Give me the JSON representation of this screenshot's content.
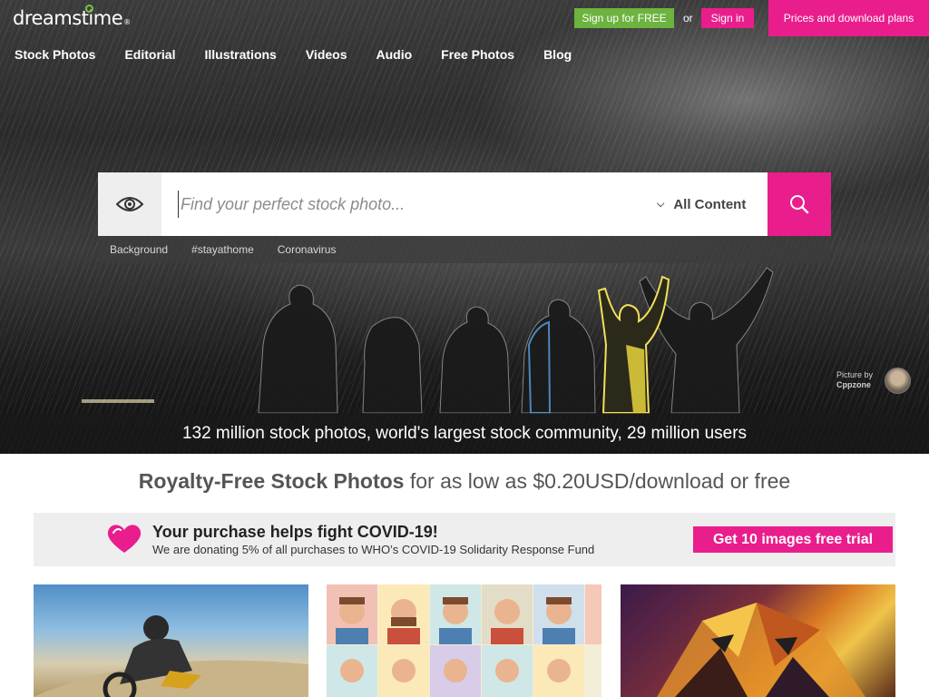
{
  "header": {
    "logo_text": "dreamstime",
    "logo_mark": "®",
    "signup_label": "Sign up for FREE",
    "or_text": "or",
    "signin_label": "Sign in",
    "prices_label": "Prices and download plans"
  },
  "nav": {
    "items": [
      "Stock Photos",
      "Editorial",
      "Illustrations",
      "Videos",
      "Audio",
      "Free Photos",
      "Blog"
    ]
  },
  "search": {
    "placeholder": "Find your perfect stock photo...",
    "value": "",
    "content_filter": "All Content",
    "tags": [
      "Background",
      "#stayathome",
      "Coronavirus"
    ]
  },
  "hero": {
    "credit_label": "Picture by",
    "credit_author": "Cppzone",
    "stats": "132 million stock photos, world's largest stock community, 29 million users"
  },
  "tagline": {
    "strong": "Royalty-Free Stock Photos",
    "rest": " for as low as $0.20USD/download or free"
  },
  "covid": {
    "title": "Your purchase helps fight COVID-19!",
    "subtitle": "We are donating 5% of all purchases to WHO’s COVID-19 Solidarity Response Fund",
    "cta": "Get 10 images free trial"
  },
  "colors": {
    "brand_pink": "#e91e8c",
    "brand_green": "#6cb33f"
  },
  "icons": {
    "search": "magnifier-icon",
    "visual_search": "eye-icon",
    "heart": "heart-icon"
  }
}
